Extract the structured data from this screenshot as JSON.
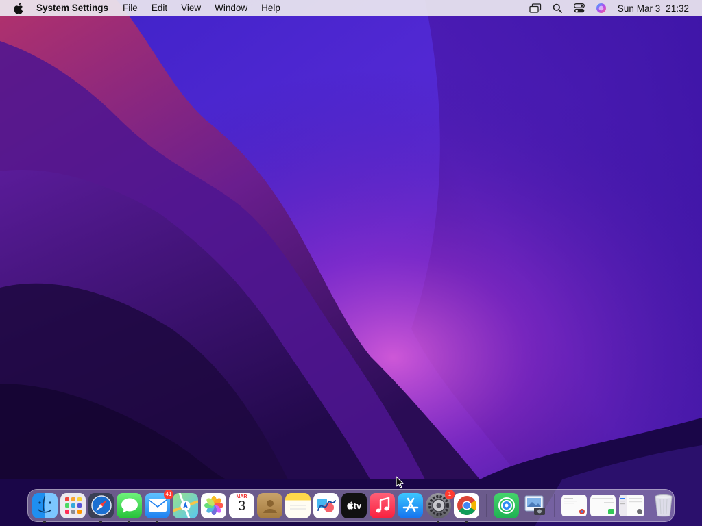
{
  "menubar": {
    "app_name": "System Settings",
    "menus": [
      "File",
      "Edit",
      "View",
      "Window",
      "Help"
    ],
    "status_icons": [
      "screen-mirroring-icon",
      "search-icon",
      "control-center-icon",
      "siri-icon"
    ],
    "date": "Sun Mar 3",
    "time": "21:32"
  },
  "dock": {
    "apps": [
      {
        "name": "Finder",
        "running": true
      },
      {
        "name": "Launchpad",
        "running": false
      },
      {
        "name": "Safari",
        "running": true
      },
      {
        "name": "Messages",
        "running": true
      },
      {
        "name": "Mail",
        "running": true,
        "badge": "41"
      },
      {
        "name": "Maps",
        "running": false
      },
      {
        "name": "Photos",
        "running": false
      },
      {
        "name": "Calendar",
        "running": false,
        "month": "MAR",
        "day": "3"
      },
      {
        "name": "Contacts",
        "running": false
      },
      {
        "name": "Notes",
        "running": false
      },
      {
        "name": "Freeform",
        "running": false
      },
      {
        "name": "TV",
        "running": false,
        "label": "tv"
      },
      {
        "name": "Music",
        "running": false
      },
      {
        "name": "App Store",
        "running": false
      },
      {
        "name": "System Settings",
        "running": true,
        "badge": "1"
      },
      {
        "name": "Google Chrome",
        "running": true
      }
    ],
    "extra_apps": [
      {
        "name": "Find My",
        "running": false
      },
      {
        "name": "Preview",
        "running": false
      }
    ],
    "minimized_windows": [
      "Chrome window",
      "Messages window",
      "System Settings window"
    ],
    "trash": "Trash"
  },
  "colors": {
    "wallpaper_dark": "#1c0840",
    "wallpaper_mid": "#4a1aa8",
    "wallpaper_glow": "#c24bd6",
    "menubar_bg": "#ece8f0"
  }
}
